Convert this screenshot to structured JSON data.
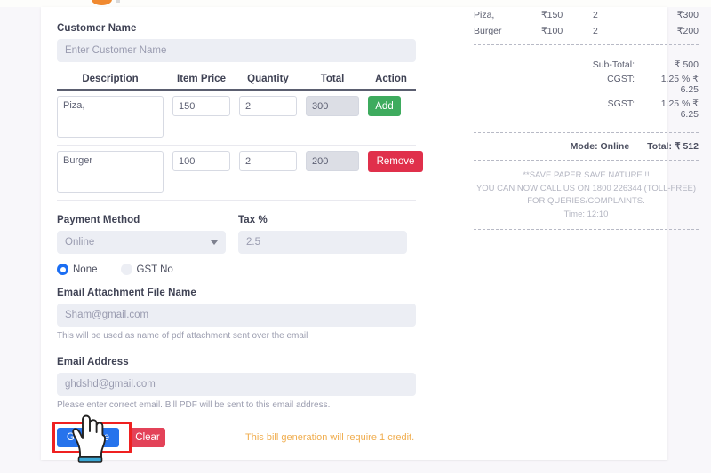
{
  "form": {
    "customer_name": {
      "label": "Customer Name",
      "placeholder": "Enter Customer Name",
      "value": ""
    },
    "items_table": {
      "headers": [
        "Description",
        "Item Price",
        "Quantity",
        "Total",
        "Action"
      ],
      "rows": [
        {
          "description": "Piza,",
          "item_price": "150",
          "quantity": "2",
          "total": "300",
          "action_label": "Add",
          "action_kind": "add"
        },
        {
          "description": "Burger",
          "item_price": "100",
          "quantity": "2",
          "total": "200",
          "action_label": "Remove",
          "action_kind": "remove"
        }
      ]
    },
    "payment_method": {
      "label": "Payment Method",
      "selected": "Online",
      "options": [
        "Online"
      ]
    },
    "tax_percent": {
      "label": "Tax %",
      "placeholder": "2.5",
      "value": ""
    },
    "gst_choice": {
      "options": [
        {
          "label": "None",
          "checked": true
        },
        {
          "label": "GST No",
          "checked": false
        }
      ]
    },
    "attachment_name": {
      "label": "Email Attachment File Name",
      "placeholder": "Sham@gmail.com",
      "value": "",
      "help": "This will be used as name of pdf attachment sent over the email"
    },
    "email_address": {
      "label": "Email Address",
      "placeholder": "ghdshd@gmail.com",
      "value": "",
      "help": "Please enter correct email. Bill PDF will be sent to this email address."
    },
    "actions": {
      "generate_label": "Generate",
      "clear_label": "Clear",
      "credit_note": "This bill generation will require 1 credit."
    }
  },
  "receipt": {
    "line_items": [
      {
        "name": "Piza,",
        "price": "₹150",
        "qty": "2",
        "total": "₹300"
      },
      {
        "name": "Burger",
        "price": "₹100",
        "qty": "2",
        "total": "₹200"
      }
    ],
    "totals": [
      {
        "label": "Sub-Total:",
        "value": "₹ 500"
      },
      {
        "label": "CGST:",
        "value": "1.25 %  ₹ 6.25"
      },
      {
        "label": "SGST:",
        "value": "1.25 %  ₹ 6.25"
      }
    ],
    "mode": "Mode: Online",
    "grand_total": "Total: ₹ 512",
    "footer_lines": [
      "**SAVE PAPER SAVE NATURE !!",
      "YOU CAN NOW CALL US ON 1800 226344 (TOLL-FREE) FOR QUERIES/COMPLAINTS.",
      "Time: 12:10"
    ]
  },
  "annotation": {
    "highlight_color": "#ef2020",
    "target": "Generate"
  },
  "colors": {
    "accent_blue": "#2673ec",
    "danger_red": "#e34258",
    "success_green": "#3eab5e",
    "remove_red": "#e0304b",
    "credit_orange": "#f0ad4e",
    "logo_orange": "#f0892f"
  }
}
